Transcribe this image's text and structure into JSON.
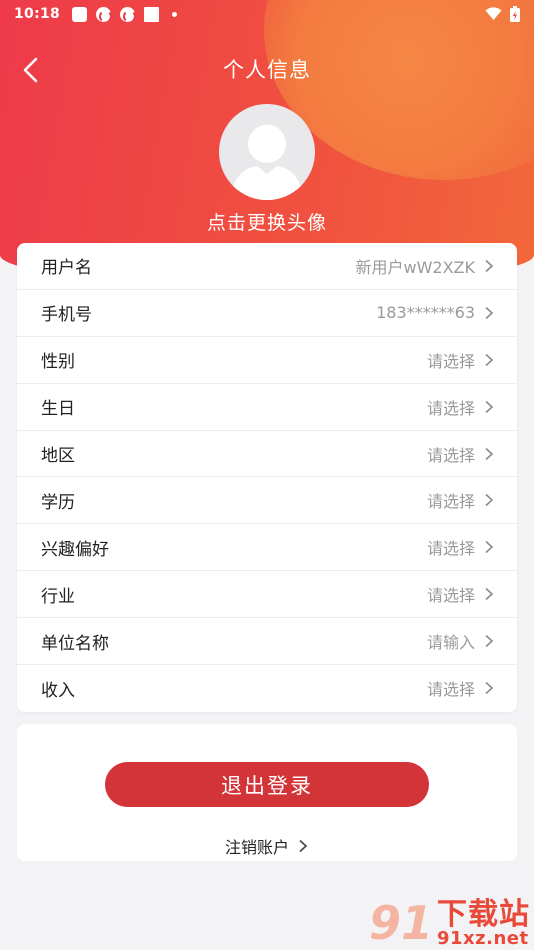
{
  "status_bar": {
    "time": "10:18"
  },
  "header": {
    "title": "个人信息",
    "avatar_caption": "点击更换头像"
  },
  "profile_rows": [
    {
      "label": "用户名",
      "value": "新用户wW2XZK"
    },
    {
      "label": "手机号",
      "value": "183******63"
    },
    {
      "label": "性别",
      "value": "请选择"
    },
    {
      "label": "生日",
      "value": "请选择"
    },
    {
      "label": "地区",
      "value": "请选择"
    },
    {
      "label": "学历",
      "value": "请选择"
    },
    {
      "label": "兴趣偏好",
      "value": "请选择"
    },
    {
      "label": "行业",
      "value": "请选择"
    },
    {
      "label": "单位名称",
      "value": "请输入"
    },
    {
      "label": "收入",
      "value": "请选择"
    }
  ],
  "actions": {
    "logout_label": "退出登录",
    "cancel_account_label": "注销账户"
  },
  "watermark": {
    "title": "下载站",
    "url": "91xz.net",
    "mark": "91"
  },
  "colors": {
    "header_start": "#ee3a4a",
    "header_end": "#f2683a",
    "logout_button": "#d23438",
    "placeholder_text": "#9a9a9a"
  }
}
